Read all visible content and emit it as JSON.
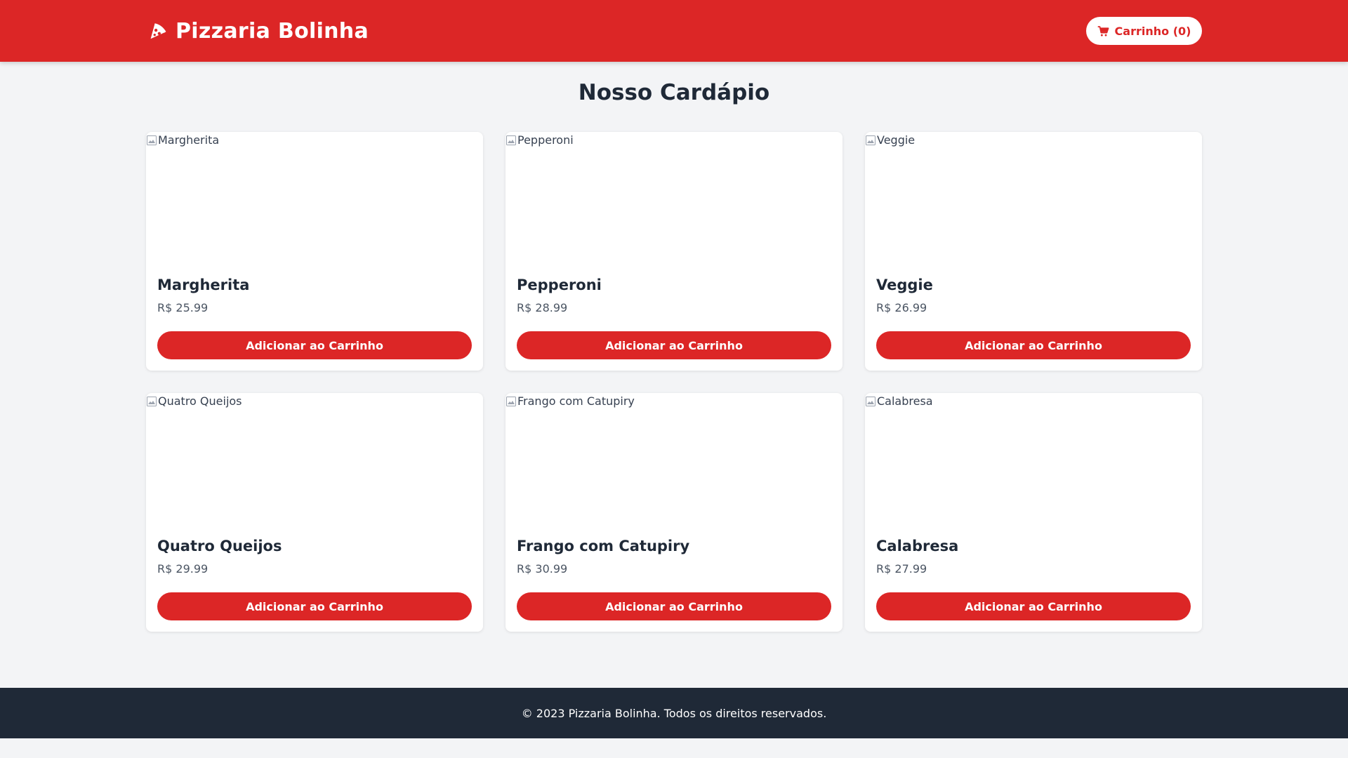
{
  "colors": {
    "brand": "#dc2626",
    "footer_bg": "#1f2937",
    "page_bg": "#f3f4f6"
  },
  "header": {
    "logo_icon": "pizza-slice-icon",
    "brand_name": "Pizzaria Bolinha",
    "cart_icon": "shopping-cart-icon",
    "cart_label": "Carrinho (0)"
  },
  "main": {
    "title": "Nosso Cardápio",
    "add_button_label": "Adicionar ao Carrinho",
    "pizzas": [
      {
        "name": "Margherita",
        "image_alt": "Margherita",
        "price": "R$ 25.99"
      },
      {
        "name": "Pepperoni",
        "image_alt": "Pepperoni",
        "price": "R$ 28.99"
      },
      {
        "name": "Veggie",
        "image_alt": "Veggie",
        "price": "R$ 26.99"
      },
      {
        "name": "Quatro Queijos",
        "image_alt": "Quatro Queijos",
        "price": "R$ 29.99"
      },
      {
        "name": "Frango com Catupiry",
        "image_alt": "Frango com Catupiry",
        "price": "R$ 30.99"
      },
      {
        "name": "Calabresa",
        "image_alt": "Calabresa",
        "price": "R$ 27.99"
      }
    ]
  },
  "footer": {
    "text": "© 2023 Pizzaria Bolinha. Todos os direitos reservados."
  }
}
